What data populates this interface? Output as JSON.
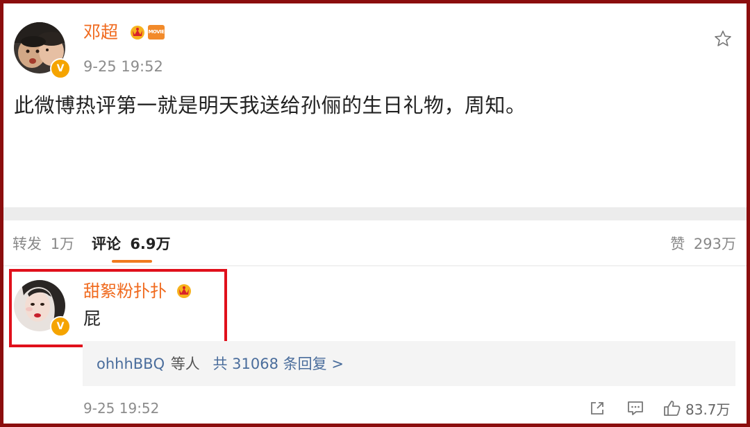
{
  "post": {
    "author": "邓超",
    "time": "9-25 19:52",
    "content": "此微博热评第一就是明天我送给孙俪的生日礼物，周知。",
    "badge_text": "MOVIE"
  },
  "tabs": {
    "repost_label": "转发",
    "repost_count": "1万",
    "comment_label": "评论",
    "comment_count": "6.9万",
    "like_label": "赞",
    "like_count": "293万"
  },
  "comment": {
    "author": "甜絮粉扑扑",
    "text": "屁",
    "reply_user": "ohhhBBQ",
    "reply_mid": "等人",
    "reply_link": "共 31068 条回复 >",
    "time": "9-25 19:52",
    "like_count": "83.7万"
  },
  "colors": {
    "frame": "#8b0d0d",
    "name": "#f06a1e",
    "tab_underline": "#f07a1e",
    "highlight_box": "#e0101b",
    "link": "#4a6d9c",
    "verified_badge": "#f5a400"
  }
}
